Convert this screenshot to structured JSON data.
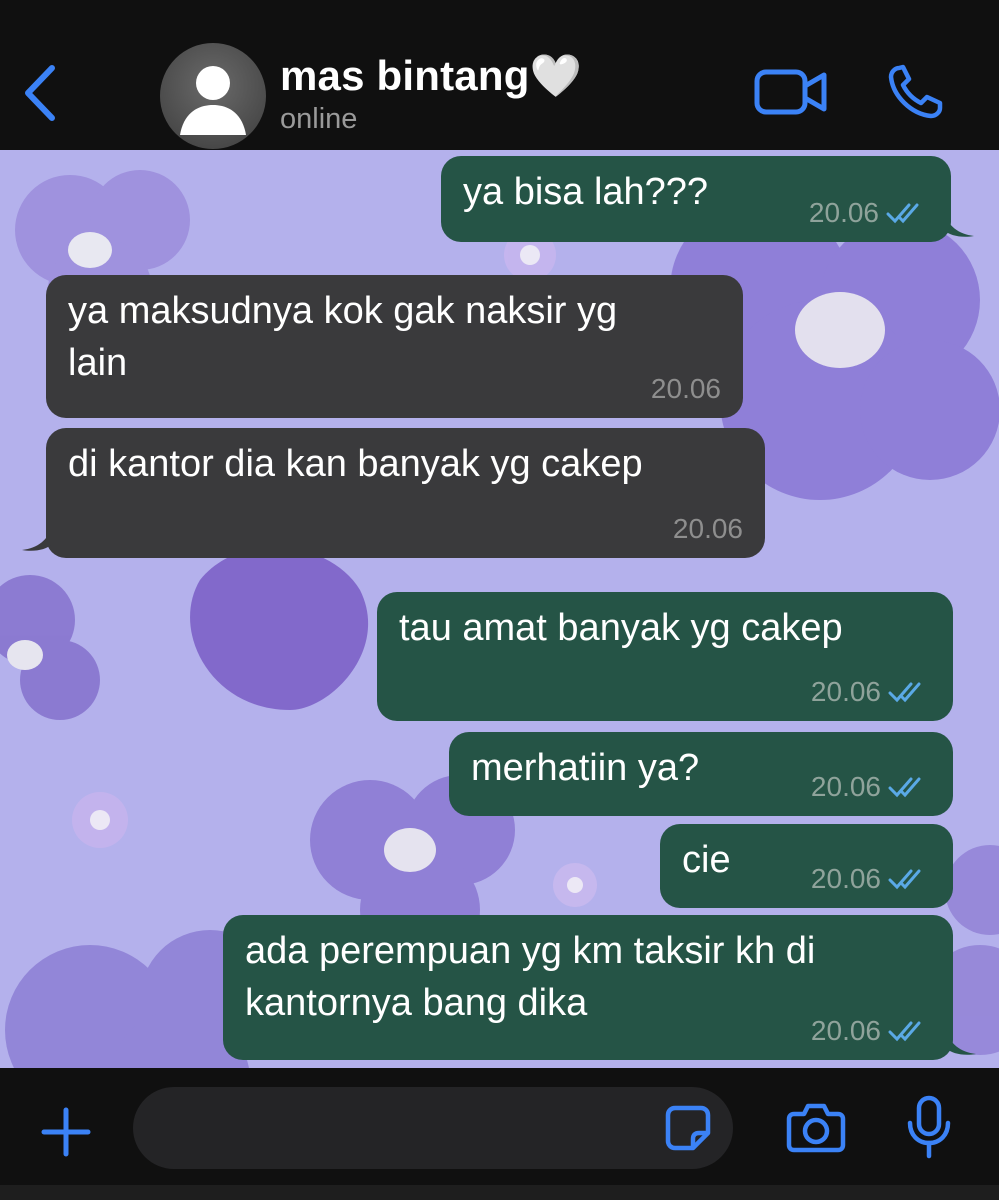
{
  "header": {
    "contact_name": "mas bintang🤍",
    "status": "online",
    "icons": {
      "back": "chevron-left-icon",
      "video": "video-camera-icon",
      "call": "phone-icon",
      "avatar": "default-avatar-icon"
    },
    "accent_color": "#3b82f6"
  },
  "messages": [
    {
      "direction": "outgoing",
      "text": "ya bisa lah???",
      "time": "20.06",
      "status": "read"
    },
    {
      "direction": "incoming",
      "text": "ya maksudnya kok gak naksir yg\nlain",
      "time": "20.06"
    },
    {
      "direction": "incoming",
      "text": "di kantor dia kan banyak yg cakep",
      "time": "20.06"
    },
    {
      "direction": "outgoing",
      "text": "tau amat banyak yg cakep",
      "time": "20.06",
      "status": "read"
    },
    {
      "direction": "outgoing",
      "text": "merhatiin ya?",
      "time": "20.06",
      "status": "read"
    },
    {
      "direction": "outgoing",
      "text": "cie",
      "time": "20.06",
      "status": "read"
    },
    {
      "direction": "outgoing",
      "text": "ada perempuan yg km taksir kh di\nkantornya bang dika",
      "time": "20.06",
      "status": "read"
    }
  ],
  "input": {
    "placeholder": "",
    "icons": {
      "attach": "plus-icon",
      "sticker": "sticker-icon",
      "camera": "camera-icon",
      "mic": "microphone-icon"
    }
  },
  "colors": {
    "outgoing_bubble": "#255446",
    "incoming_bubble": "#3a3a3c",
    "wallpaper": "#b4b1ec",
    "read_ticks": "#5aa9e6"
  }
}
